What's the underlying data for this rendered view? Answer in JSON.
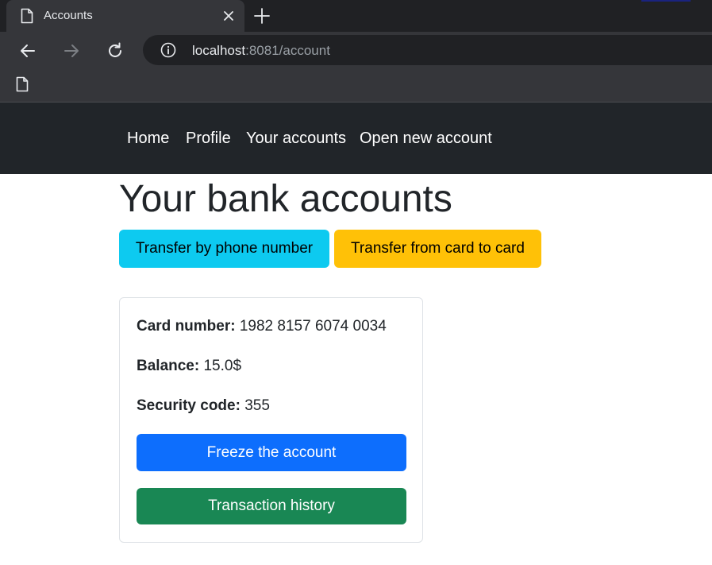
{
  "browser": {
    "tab_title": "Accounts",
    "url_host": "localhost",
    "url_rest": ":8081/account"
  },
  "nav": {
    "items": [
      {
        "label": "Home"
      },
      {
        "label": "Profile"
      },
      {
        "label": "Your accounts"
      },
      {
        "label": "Open new account"
      }
    ]
  },
  "page": {
    "title": "Your bank accounts",
    "transfer_phone_label": "Transfer by phone number",
    "transfer_card_label": "Transfer from card to card"
  },
  "account": {
    "card_number_label": "Card number:",
    "card_number": "1982 8157 6074 0034",
    "balance_label": "Balance:",
    "balance": "15.0$",
    "security_code_label": "Security code:",
    "security_code": "355",
    "freeze_label": "Freeze the account",
    "history_label": "Transaction history"
  },
  "colors": {
    "navbar": "#212529",
    "info_button": "#0dcaf0",
    "warning_button": "#ffc107",
    "primary_button": "#0d6efd",
    "success_button": "#198754"
  }
}
